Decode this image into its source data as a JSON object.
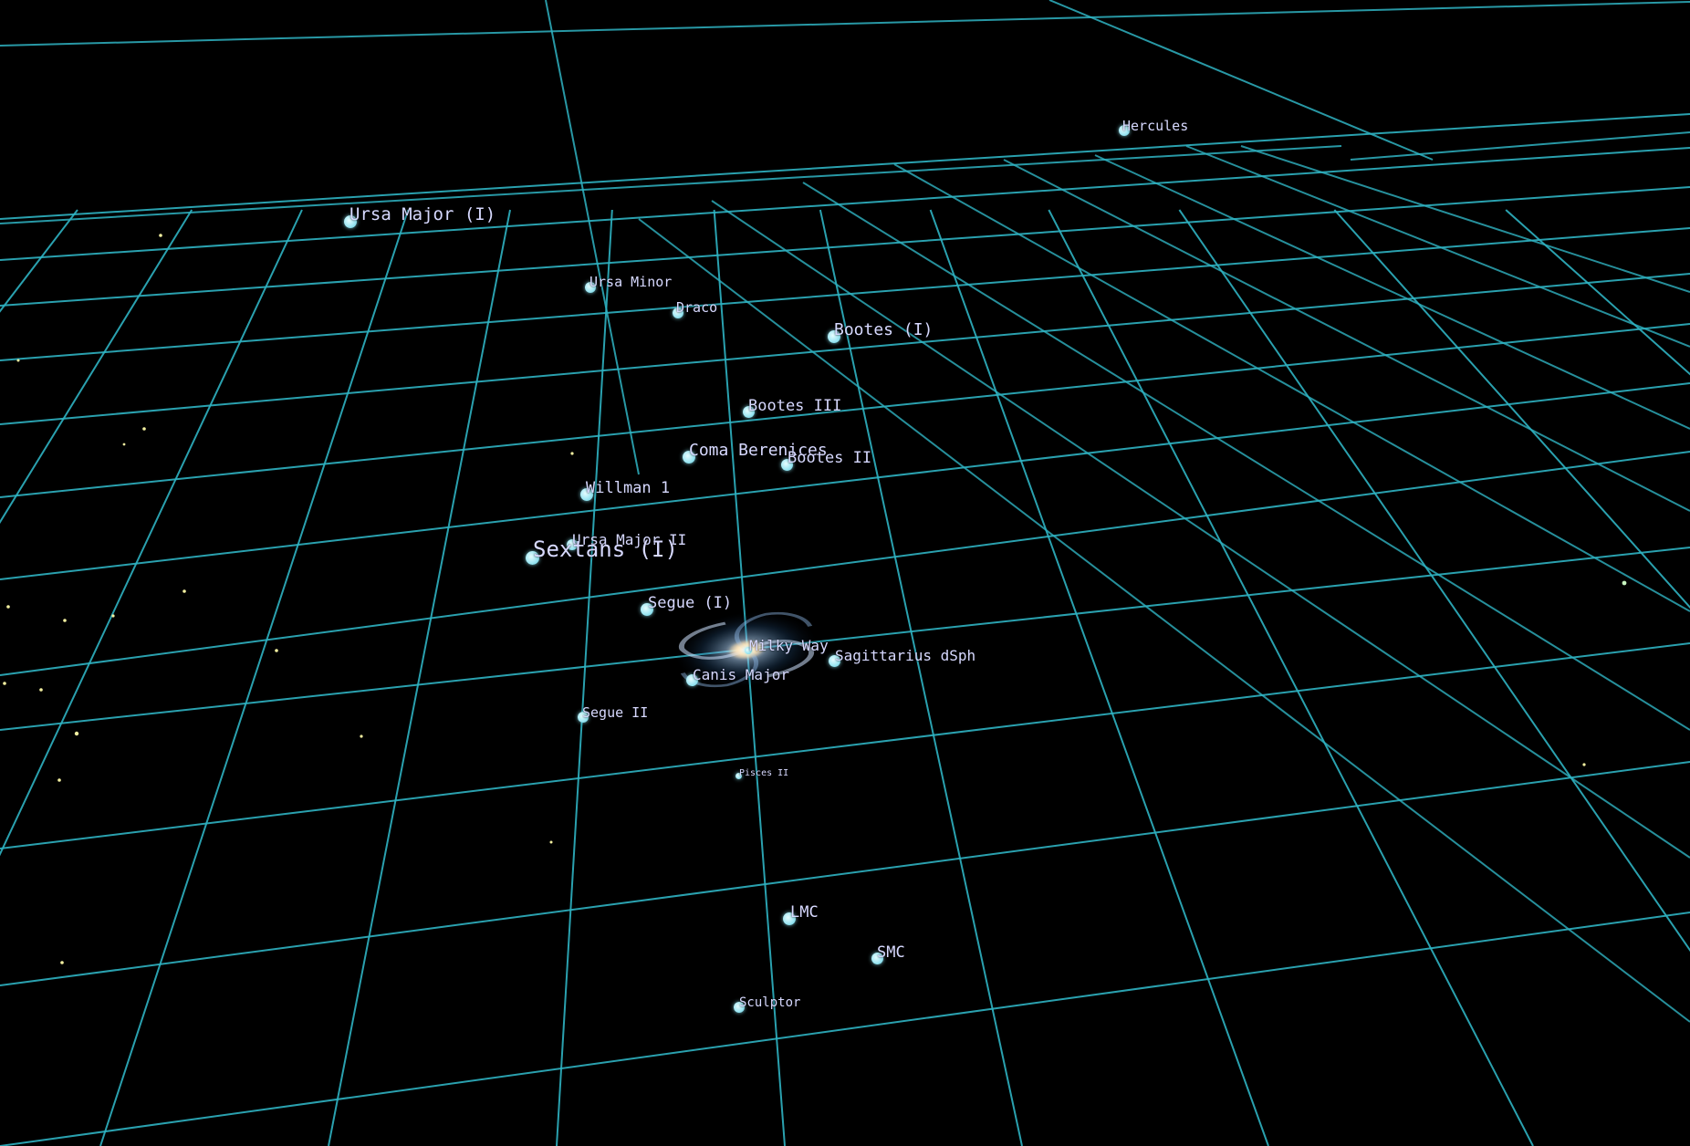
{
  "scene": {
    "background_color": "#000000",
    "grid_color": "#2fb3c2",
    "star_color": "#f3f0a0",
    "dot_color": "#9fe7f3",
    "label_color": "#d7d9ff"
  },
  "objects": {
    "hercules": "Hercules",
    "ursa_major_i": "Ursa Major (I)",
    "ursa_minor": "Ursa Minor",
    "draco": "Draco",
    "bootes_i": "Bootes (I)",
    "bootes_iii": "Bootes III",
    "coma_berenices": "Coma Berenices",
    "bootes_ii": "Bootes II",
    "willman_1": "Willman 1",
    "ursa_major_ii": "Ursa Major II",
    "sextans_i": "Sextans (I)",
    "segue_i": "Segue (I)",
    "milky_way": "Milky Way",
    "sagittarius_dsph": "Sagittarius dSph",
    "canis_major": "Canis Major",
    "segue_ii": "Segue II",
    "pisces_ii": "Pisces II",
    "lmc": "LMC",
    "smc": "SMC",
    "sculptor": "Sculptor"
  }
}
